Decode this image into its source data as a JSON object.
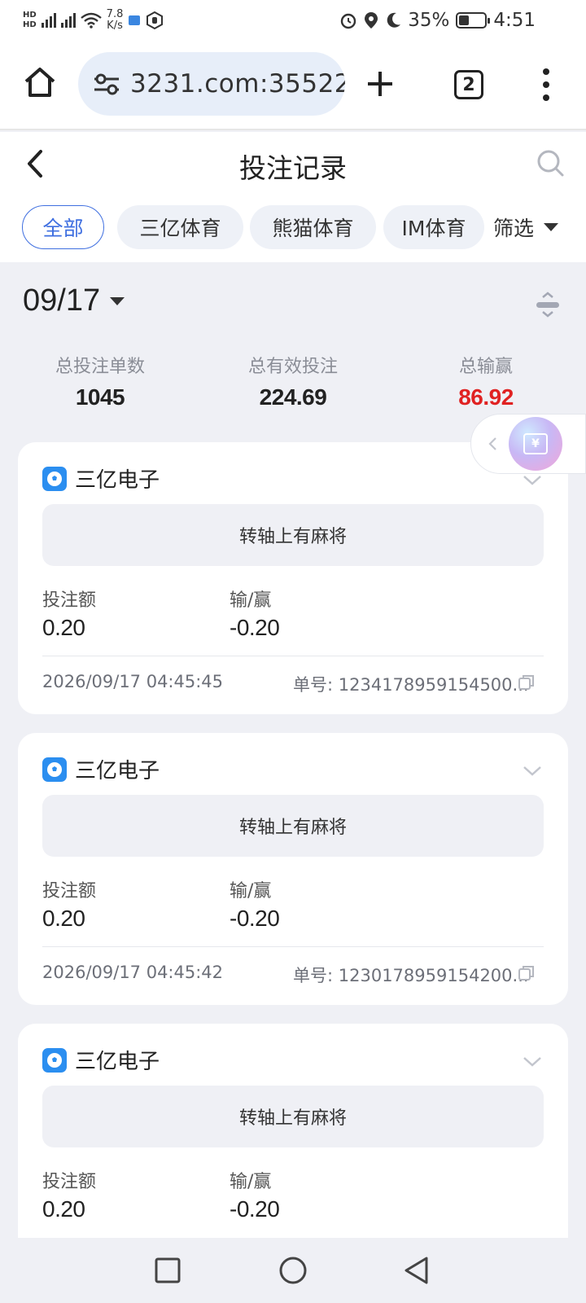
{
  "status_bar": {
    "net1": "HD",
    "net2": "HD",
    "speed_value": "7.8",
    "speed_unit": "K/s",
    "battery": "35%",
    "time": "4:51"
  },
  "browser": {
    "url": "3231.com:35522",
    "tab_count": "2"
  },
  "header": {
    "title": "投注记录"
  },
  "filters": {
    "chips": [
      "全部",
      "三亿体育",
      "熊猫体育",
      "IM体育"
    ],
    "filter_label": "筛选"
  },
  "date": "09/17",
  "summary": {
    "total_count_label": "总投注单数",
    "total_count": "1045",
    "valid_bet_label": "总有效投注",
    "valid_bet": "224.69",
    "win_loss_label": "总输赢",
    "win_loss": "86.92"
  },
  "bets": [
    {
      "provider": "三亿电子",
      "game": "转轴上有麻将",
      "bet_label": "投注额",
      "bet": "0.20",
      "result_label": "输/赢",
      "result": "-0.20",
      "time": "2026/09/17 04:45:45",
      "order": "单号: 1234178959154500..."
    },
    {
      "provider": "三亿电子",
      "game": "转轴上有麻将",
      "bet_label": "投注额",
      "bet": "0.20",
      "result_label": "输/赢",
      "result": "-0.20",
      "time": "2026/09/17 04:45:42",
      "order": "单号: 1230178959154200..."
    },
    {
      "provider": "三亿电子",
      "game": "转轴上有麻将",
      "bet_label": "投注额",
      "bet": "0.20",
      "result_label": "输/赢",
      "result": "-0.20",
      "time": "",
      "order": ""
    }
  ],
  "colors": {
    "accent": "#3f6fe0",
    "negative": "#e02222",
    "page_bg": "#eff0f5"
  }
}
